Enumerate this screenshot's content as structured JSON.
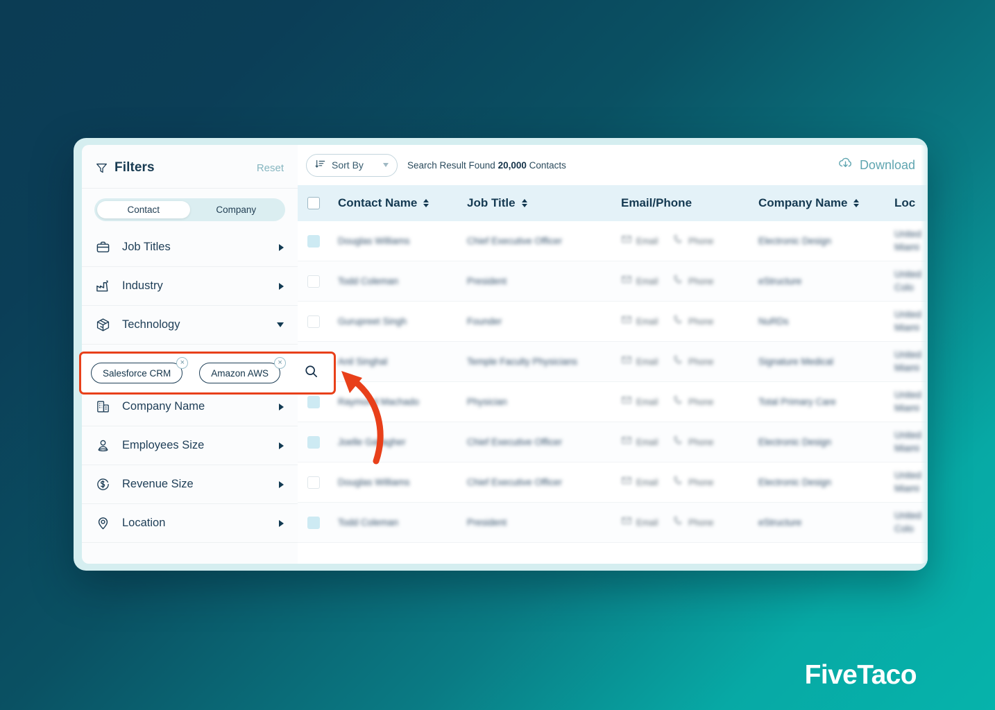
{
  "brand": {
    "name": "FiveTaco"
  },
  "sidebar": {
    "title": "Filters",
    "reset_label": "Reset",
    "toggle": {
      "options": [
        "Contact",
        "Company"
      ],
      "active": "Contact"
    },
    "items": [
      {
        "label": "Job Titles",
        "icon": "briefcase-icon",
        "expanded": false
      },
      {
        "label": "Industry",
        "icon": "factory-icon",
        "expanded": false
      },
      {
        "label": "Technology",
        "icon": "cube-icon",
        "expanded": true
      },
      {
        "label": "Company Name",
        "icon": "building-icon",
        "expanded": false
      },
      {
        "label": "Employees Size",
        "icon": "person-icon",
        "expanded": false
      },
      {
        "label": "Revenue Size",
        "icon": "dollar-circle-icon",
        "expanded": false
      },
      {
        "label": "Location",
        "icon": "map-pin-icon",
        "expanded": false
      }
    ],
    "technology_tags": [
      "Salesforce CRM",
      "Amazon AWS"
    ],
    "tag_remove_glyph": "×",
    "highlight_color": "#e8401a"
  },
  "toolbar": {
    "sort_label": "Sort By",
    "result_prefix": "Search Result Found ",
    "result_count": "20,000",
    "result_suffix": " Contacts",
    "download_label": "Download"
  },
  "table": {
    "columns": [
      {
        "label": "Contact Name",
        "sortable": true
      },
      {
        "label": "Job Title",
        "sortable": true
      },
      {
        "label": "Email/Phone",
        "sortable": false
      },
      {
        "label": "Company Name",
        "sortable": true
      },
      {
        "label": "Loc",
        "sortable": false
      }
    ],
    "email_label": "Email",
    "phone_label": "Phone",
    "rows": [
      {
        "selected": true,
        "name": "Douglas Williams",
        "title": "Chief Executive Officer",
        "company": "Electronic Design",
        "loc1": "United",
        "loc2": "Miami"
      },
      {
        "selected": false,
        "name": "Todd Coleman",
        "title": "President",
        "company": "eStructure",
        "loc1": "United",
        "loc2": "Colo"
      },
      {
        "selected": false,
        "name": "Gurupreet Singh",
        "title": "Founder",
        "company": "NuRDs",
        "loc1": "United",
        "loc2": "Miami"
      },
      {
        "selected": false,
        "name": "Anil Singhal",
        "title": "Temple Faculty Physicians",
        "company": "Signature Medical",
        "loc1": "United",
        "loc2": "Miami"
      },
      {
        "selected": true,
        "name": "Raymond Machado",
        "title": "Physician",
        "company": "Total Primary Care",
        "loc1": "United",
        "loc2": "Miami"
      },
      {
        "selected": true,
        "name": "Joelle Gallagher",
        "title": "Chief Executive Officer",
        "company": "Electronic Design",
        "loc1": "United",
        "loc2": "Miami"
      },
      {
        "selected": false,
        "name": "Douglas Williams",
        "title": "Chief Executive Officer",
        "company": "Electronic Design",
        "loc1": "United",
        "loc2": "Miami"
      },
      {
        "selected": true,
        "name": "Todd Coleman",
        "title": "President",
        "company": "eStructure",
        "loc1": "United",
        "loc2": "Colo"
      }
    ]
  },
  "colors": {
    "bg_dark": "#0b3c54",
    "bg_teal": "#06b3ab",
    "card_frame": "#d5eef0",
    "header_row": "#e4f2f8",
    "accent_text": "#153a52",
    "download_teal": "#5fa5b0",
    "highlight_red": "#e8401a"
  }
}
